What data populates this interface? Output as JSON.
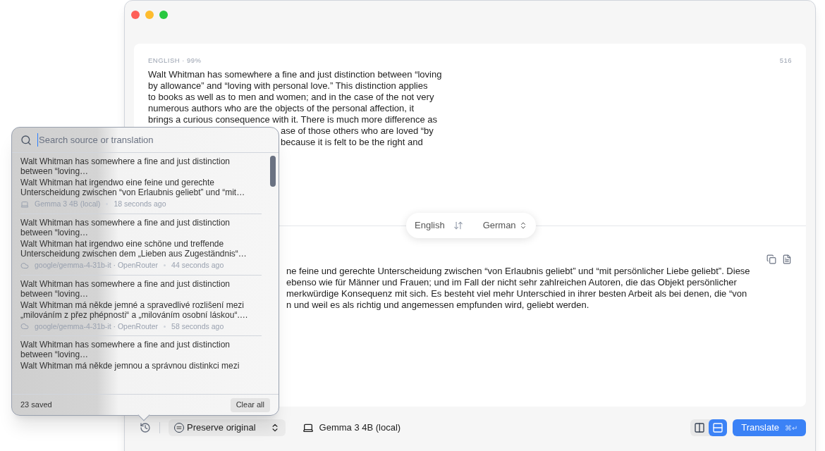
{
  "source": {
    "label": "ENGLISH · 99%",
    "count": "516",
    "lines": [
      "Walt Whitman has somewhere a fine and just distinction between “loving",
      "by allowance” and “loving with personal love.” This distinction applies",
      "to books as well as to men and women; and in the case of the not very",
      "numerous authors who are the objects of the personal affection, it",
      "brings a curious consequence with it. There is much more difference as"
    ],
    "fragments": [
      "ase of those others who are loved “by",
      "because it is felt to be the right and"
    ]
  },
  "languages": {
    "from": "English",
    "to": "German"
  },
  "target": {
    "lines": [
      "ne feine und gerechte Unterscheidung zwischen “von Erlaubnis geliebt” und “mit persönlicher Liebe geliebt”. Diese",
      "ebenso wie für Männer und Frauen; und im Fall der nicht sehr zahlreichen Autoren, die das Objekt persönlicher",
      "merkwürdige Konsequenz mit sich. Es besteht viel mehr Unterschied in ihrer besten Arbeit als bei denen, die “von",
      "n und weil es als richtig und angemessen empfunden wird, geliebt werden."
    ]
  },
  "history": {
    "search_placeholder": "Search source or translation",
    "items": [
      {
        "source": "Walt Whitman has somewhere a fine and just distinction between “loving…",
        "translation": "Walt Whitman hat irgendwo eine feine und gerechte Unterscheidung zwischen “von Erlaubnis geliebt” und “mit…",
        "kind": "local",
        "model": "Gemma 3 4B (local)",
        "time": "18 seconds ago"
      },
      {
        "source": "Walt Whitman has somewhere a fine and just distinction between “loving…",
        "translation": "Walt Whitman hat irgendwo eine schöne und treffende Unterscheidung zwischen dem „Lieben aus Zugeständnis“…",
        "kind": "cloud",
        "model": "google/gemma-4-31b-it · OpenRouter",
        "time": "44 seconds ago"
      },
      {
        "source": "Walt Whitman has somewhere a fine and just distinction between “loving…",
        "translation": "Walt Whitman má někde jemné a spravedlivé rozlišení mezi „milováním z přez phépnosti“ a „milováním osobní láskou“.…",
        "kind": "cloud",
        "model": "google/gemma-4-31b-it · OpenRouter",
        "time": "58 seconds ago"
      },
      {
        "source": "Walt Whitman has somewhere a fine and just distinction between “loving…",
        "translation": "Walt Whitman má někde jemnou a správnou distinkci mezi"
      }
    ],
    "saved": "23 saved",
    "clear": "Clear all"
  },
  "toolbar": {
    "mode": "Preserve original",
    "model": "Gemma 3 4B (local)",
    "layouts": [
      {
        "kind": "columns",
        "selected": false
      },
      {
        "kind": "rows",
        "selected": true
      }
    ],
    "translate": "Translate",
    "shortcut": "⌘↵"
  }
}
